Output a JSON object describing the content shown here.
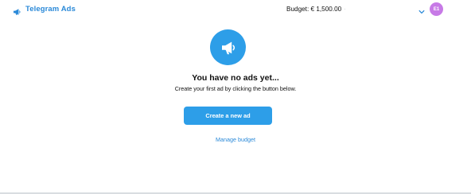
{
  "header": {
    "app_name": "Telegram Ads",
    "logo_icon": "megaphone-icon",
    "budget_label": "Budget: € 1,500.00",
    "budget_separator": "·",
    "account_menu_icon": "chevron-down-icon",
    "avatar_initials": "E1"
  },
  "empty_state": {
    "icon": "megaphone-icon",
    "title": "You have no ads yet...",
    "subtitle": "Create your first ad by clicking the button below.",
    "create_button_label": "Create a new ad",
    "manage_budget_label": "Manage budget"
  },
  "colors": {
    "accent": "#2d9ee8",
    "link": "#2a89d8",
    "avatar": "#c77ae6",
    "divider": "#d9dde1"
  }
}
